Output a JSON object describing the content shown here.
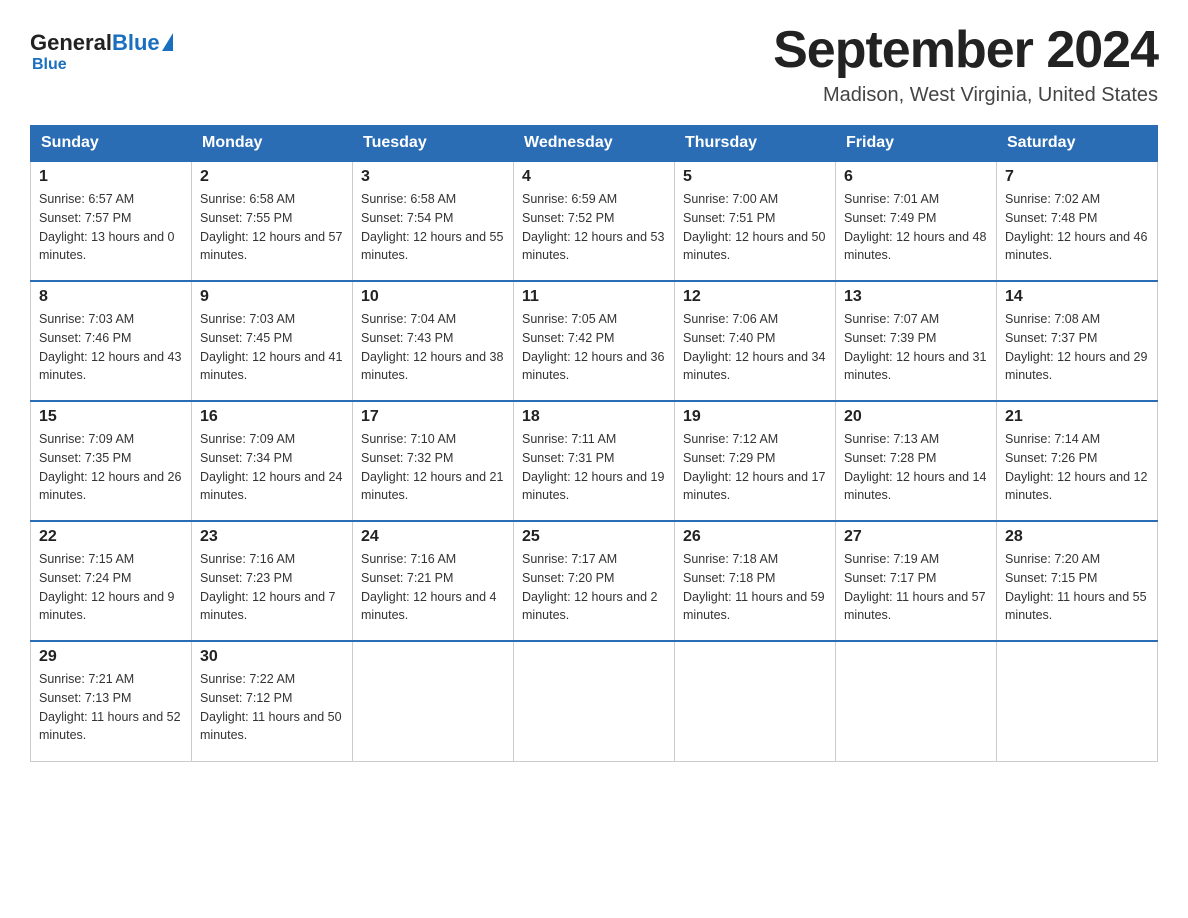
{
  "header": {
    "logo_general": "General",
    "logo_blue": "Blue",
    "title": "September 2024",
    "subtitle": "Madison, West Virginia, United States"
  },
  "days_of_week": [
    "Sunday",
    "Monday",
    "Tuesday",
    "Wednesday",
    "Thursday",
    "Friday",
    "Saturday"
  ],
  "weeks": [
    [
      {
        "day": "1",
        "sunrise": "6:57 AM",
        "sunset": "7:57 PM",
        "daylight": "13 hours and 0 minutes."
      },
      {
        "day": "2",
        "sunrise": "6:58 AM",
        "sunset": "7:55 PM",
        "daylight": "12 hours and 57 minutes."
      },
      {
        "day": "3",
        "sunrise": "6:58 AM",
        "sunset": "7:54 PM",
        "daylight": "12 hours and 55 minutes."
      },
      {
        "day": "4",
        "sunrise": "6:59 AM",
        "sunset": "7:52 PM",
        "daylight": "12 hours and 53 minutes."
      },
      {
        "day": "5",
        "sunrise": "7:00 AM",
        "sunset": "7:51 PM",
        "daylight": "12 hours and 50 minutes."
      },
      {
        "day": "6",
        "sunrise": "7:01 AM",
        "sunset": "7:49 PM",
        "daylight": "12 hours and 48 minutes."
      },
      {
        "day": "7",
        "sunrise": "7:02 AM",
        "sunset": "7:48 PM",
        "daylight": "12 hours and 46 minutes."
      }
    ],
    [
      {
        "day": "8",
        "sunrise": "7:03 AM",
        "sunset": "7:46 PM",
        "daylight": "12 hours and 43 minutes."
      },
      {
        "day": "9",
        "sunrise": "7:03 AM",
        "sunset": "7:45 PM",
        "daylight": "12 hours and 41 minutes."
      },
      {
        "day": "10",
        "sunrise": "7:04 AM",
        "sunset": "7:43 PM",
        "daylight": "12 hours and 38 minutes."
      },
      {
        "day": "11",
        "sunrise": "7:05 AM",
        "sunset": "7:42 PM",
        "daylight": "12 hours and 36 minutes."
      },
      {
        "day": "12",
        "sunrise": "7:06 AM",
        "sunset": "7:40 PM",
        "daylight": "12 hours and 34 minutes."
      },
      {
        "day": "13",
        "sunrise": "7:07 AM",
        "sunset": "7:39 PM",
        "daylight": "12 hours and 31 minutes."
      },
      {
        "day": "14",
        "sunrise": "7:08 AM",
        "sunset": "7:37 PM",
        "daylight": "12 hours and 29 minutes."
      }
    ],
    [
      {
        "day": "15",
        "sunrise": "7:09 AM",
        "sunset": "7:35 PM",
        "daylight": "12 hours and 26 minutes."
      },
      {
        "day": "16",
        "sunrise": "7:09 AM",
        "sunset": "7:34 PM",
        "daylight": "12 hours and 24 minutes."
      },
      {
        "day": "17",
        "sunrise": "7:10 AM",
        "sunset": "7:32 PM",
        "daylight": "12 hours and 21 minutes."
      },
      {
        "day": "18",
        "sunrise": "7:11 AM",
        "sunset": "7:31 PM",
        "daylight": "12 hours and 19 minutes."
      },
      {
        "day": "19",
        "sunrise": "7:12 AM",
        "sunset": "7:29 PM",
        "daylight": "12 hours and 17 minutes."
      },
      {
        "day": "20",
        "sunrise": "7:13 AM",
        "sunset": "7:28 PM",
        "daylight": "12 hours and 14 minutes."
      },
      {
        "day": "21",
        "sunrise": "7:14 AM",
        "sunset": "7:26 PM",
        "daylight": "12 hours and 12 minutes."
      }
    ],
    [
      {
        "day": "22",
        "sunrise": "7:15 AM",
        "sunset": "7:24 PM",
        "daylight": "12 hours and 9 minutes."
      },
      {
        "day": "23",
        "sunrise": "7:16 AM",
        "sunset": "7:23 PM",
        "daylight": "12 hours and 7 minutes."
      },
      {
        "day": "24",
        "sunrise": "7:16 AM",
        "sunset": "7:21 PM",
        "daylight": "12 hours and 4 minutes."
      },
      {
        "day": "25",
        "sunrise": "7:17 AM",
        "sunset": "7:20 PM",
        "daylight": "12 hours and 2 minutes."
      },
      {
        "day": "26",
        "sunrise": "7:18 AM",
        "sunset": "7:18 PM",
        "daylight": "11 hours and 59 minutes."
      },
      {
        "day": "27",
        "sunrise": "7:19 AM",
        "sunset": "7:17 PM",
        "daylight": "11 hours and 57 minutes."
      },
      {
        "day": "28",
        "sunrise": "7:20 AM",
        "sunset": "7:15 PM",
        "daylight": "11 hours and 55 minutes."
      }
    ],
    [
      {
        "day": "29",
        "sunrise": "7:21 AM",
        "sunset": "7:13 PM",
        "daylight": "11 hours and 52 minutes."
      },
      {
        "day": "30",
        "sunrise": "7:22 AM",
        "sunset": "7:12 PM",
        "daylight": "11 hours and 50 minutes."
      },
      null,
      null,
      null,
      null,
      null
    ]
  ]
}
